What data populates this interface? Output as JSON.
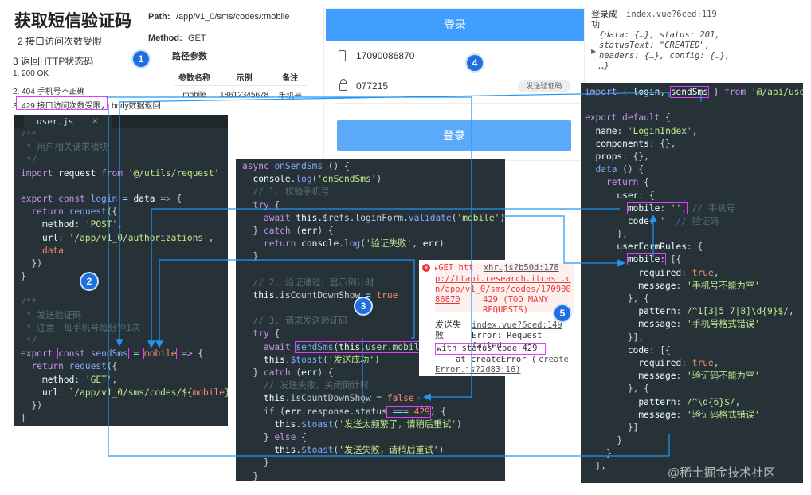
{
  "doc": {
    "title": "获取短信验证码",
    "path_label": "Path:",
    "path_value": "/app/v1_0/sms/codes/:mobile",
    "method_label": "Method:",
    "method_value": "GET",
    "point2": "2 接口访问次数受限",
    "point3": "3 返回HTTP状态码",
    "path_params": "路径参数",
    "status_list": [
      "1. 200 OK",
      "2. 404 手机号不正确",
      "3. 429 接口访问次数受限，",
      "body数据返回"
    ],
    "table": {
      "headers": [
        "参数名称",
        "示例",
        "备注"
      ],
      "row": [
        "mobile",
        "18612345678",
        "手机号"
      ]
    }
  },
  "badges": [
    "1",
    "2",
    "3",
    "4",
    "5"
  ],
  "editor": {
    "tab_label": "user.js",
    "tab_close": "×"
  },
  "login_form": {
    "header_button": "登录",
    "phone_value": "17090086870",
    "code_value": "077215",
    "send_code_button": "发送验证码",
    "submit_button": "登录"
  },
  "console_top": {
    "message": "登录成功",
    "source_link": "index.vue?6ced:119",
    "object_preview": "{data: {…}, status: 201, statusText: \"CREATED\", headers: {…}, config: {…}, …}"
  },
  "console_error": {
    "request_line": "GET htt",
    "xhr_link": "xhr.js?b50d:178",
    "url": "p://ttapi.research.itcast.cn/app/v1_0/sms/codes/17090086870",
    "status": "429 (TOO MANY REQUESTS)",
    "fail_label": "发送失败",
    "source_link": "index.vue?6ced:149",
    "error_text": "Error: Request failed",
    "status_code_text": "with status code 429",
    "at_text": "at createError (",
    "create_link": "create",
    "create_link2": "Error.js?2d83:16)"
  },
  "watermark": "@稀土掘金技术社区",
  "colors": {
    "connector": "#2196f3",
    "highlight": "#e040fb",
    "login_blue": "#409eff",
    "code_bg": "#263238"
  }
}
